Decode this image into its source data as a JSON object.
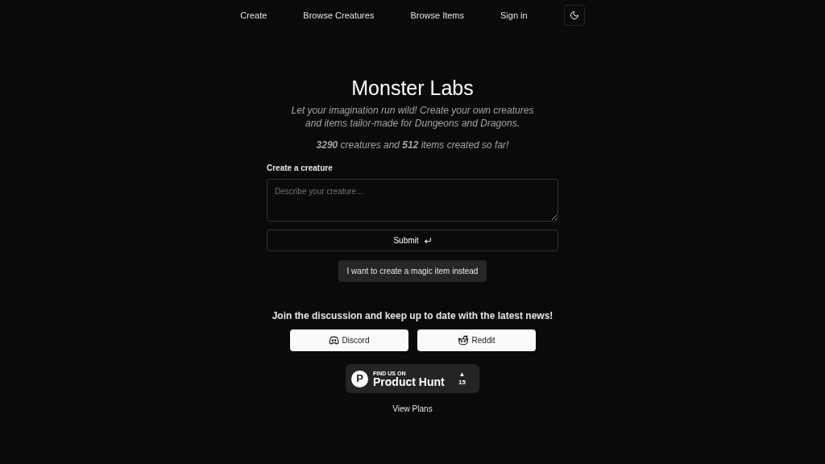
{
  "nav": {
    "links": [
      "Create",
      "Browse Creatures",
      "Browse Items",
      "Sign in"
    ]
  },
  "hero": {
    "title": "Monster Labs",
    "tagline": "Let your imagination run wild! Create your own creatures and items tailor-made for Dungeons and Dragons.",
    "stats": "**3290** creatures and **512** items created so far!"
  },
  "form": {
    "label": "Create a creature",
    "placeholder": "Describe your creature...",
    "submit": "Submit",
    "switch": "I want to create a magic item instead"
  },
  "community": {
    "heading": "Join the discussion and keep up to date with the latest news!",
    "buttons": [
      {
        "kind": "discord",
        "label": "Discord"
      },
      {
        "kind": "reddit",
        "label": "Reddit"
      }
    ]
  },
  "product_hunt": {
    "logo": "P",
    "caption": "FIND US ON",
    "name": "Product Hunt",
    "arrow": "▲",
    "count": "15"
  },
  "footer_link": "View Plans"
}
